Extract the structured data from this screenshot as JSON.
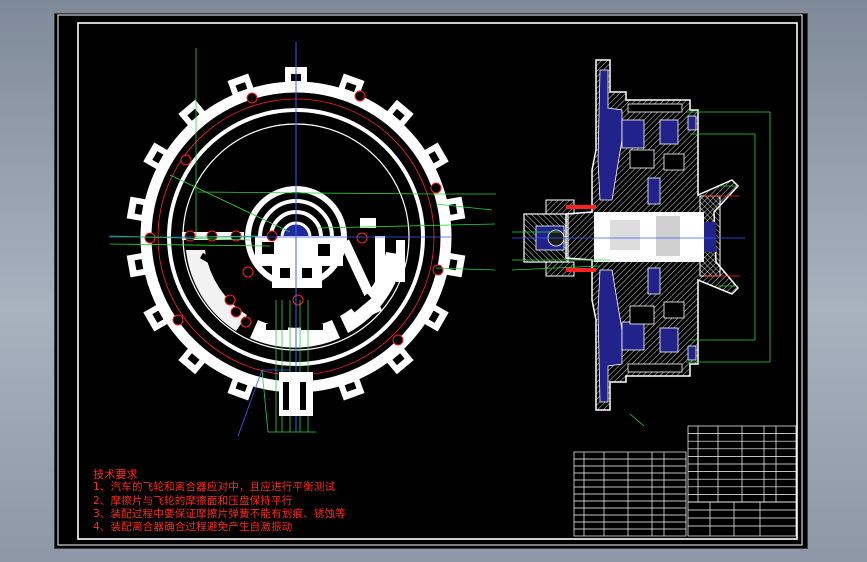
{
  "technical_requirements": {
    "heading": "技术要求",
    "items": [
      "1、汽车的飞轮和离合器应对中，且应进行平衡测试",
      "2、摩擦片与飞轮的摩擦面和压盘保持平行",
      "3、装配过程中要保证摩擦片弹簧不能有划痕、锈蚀等",
      "4、装配离合器确合过程避免产生自激振动"
    ]
  },
  "colors": {
    "sheet": "#000000",
    "outline": "#ffffff",
    "leader": "#27d43a",
    "centerline": "#ff2020",
    "section_fill": "#22238a",
    "dimension": "#3a5cff",
    "annotation_text": "#ff2a1a"
  }
}
